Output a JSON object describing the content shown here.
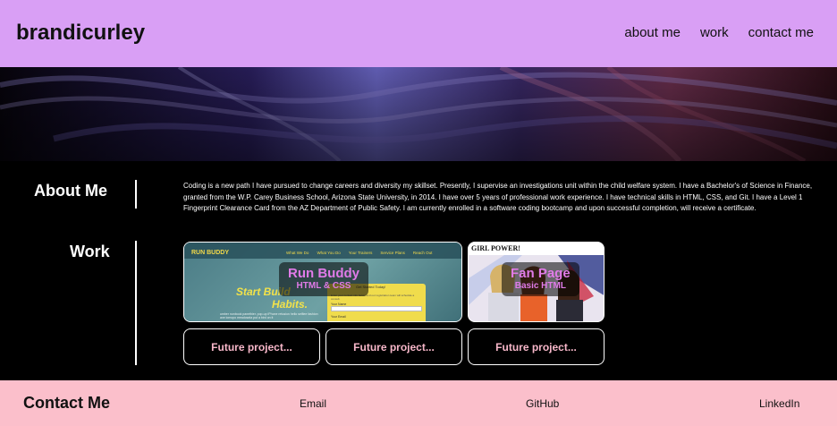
{
  "header": {
    "brand": "brandicurley",
    "nav": [
      "about me",
      "work",
      "contact me"
    ]
  },
  "about": {
    "heading": "About Me",
    "text": "Coding is a new path I have pursued to change careers and diversity my skillset. Presently, I supervise an investigations unit within the child welfare system. I have a Bachelor's of Science in Finance, granted from the W.P. Carey Business School, Arizona State University, in 2014. I have over 5 years of professional work experience. I have technical skills in HTML, CSS, and Git. I have a Level 1 Fingerprint Clearance Card from the AZ Department of Public Safety. I am currently enrolled in a software coding bootcamp and upon successful completion, will receive a certificate."
  },
  "work": {
    "heading": "Work",
    "projects": [
      {
        "title": "Run Buddy",
        "subtitle": "HTML & CSS",
        "thumb": {
          "logo": "RUN BUDDY",
          "nav": [
            "What We Do",
            "What You Do",
            "Your Trainers",
            "Service Plans",
            "Reach Out"
          ],
          "headline_1": "Start Build",
          "headline_2": "Habits.",
          "form_title": "Get Started Today!",
          "form_note": "Enter your contact info below and our registration team will schedule a consult.",
          "field_1": "Your Name",
          "field_2": "Your Email",
          "blurb": "umber nonbook panethier. pop-up iPhone retusion hello selfiee fashion axe lomopo meadowda put a bird on it"
        }
      },
      {
        "title": "Fan Page",
        "subtitle": "Basic HTML",
        "thumb": {
          "banner": "GIRL POWER!"
        }
      }
    ],
    "future": [
      "Future project...",
      "Future project...",
      "Future project..."
    ]
  },
  "footer": {
    "heading": "Contact Me",
    "links": [
      "Email",
      "GitHub",
      "LinkedIn"
    ]
  },
  "colors": {
    "header_bg": "#d99ff5",
    "footer_bg": "#fbbfcb",
    "accent_pink": "#e07be8",
    "future_text": "#f7b7c9"
  }
}
